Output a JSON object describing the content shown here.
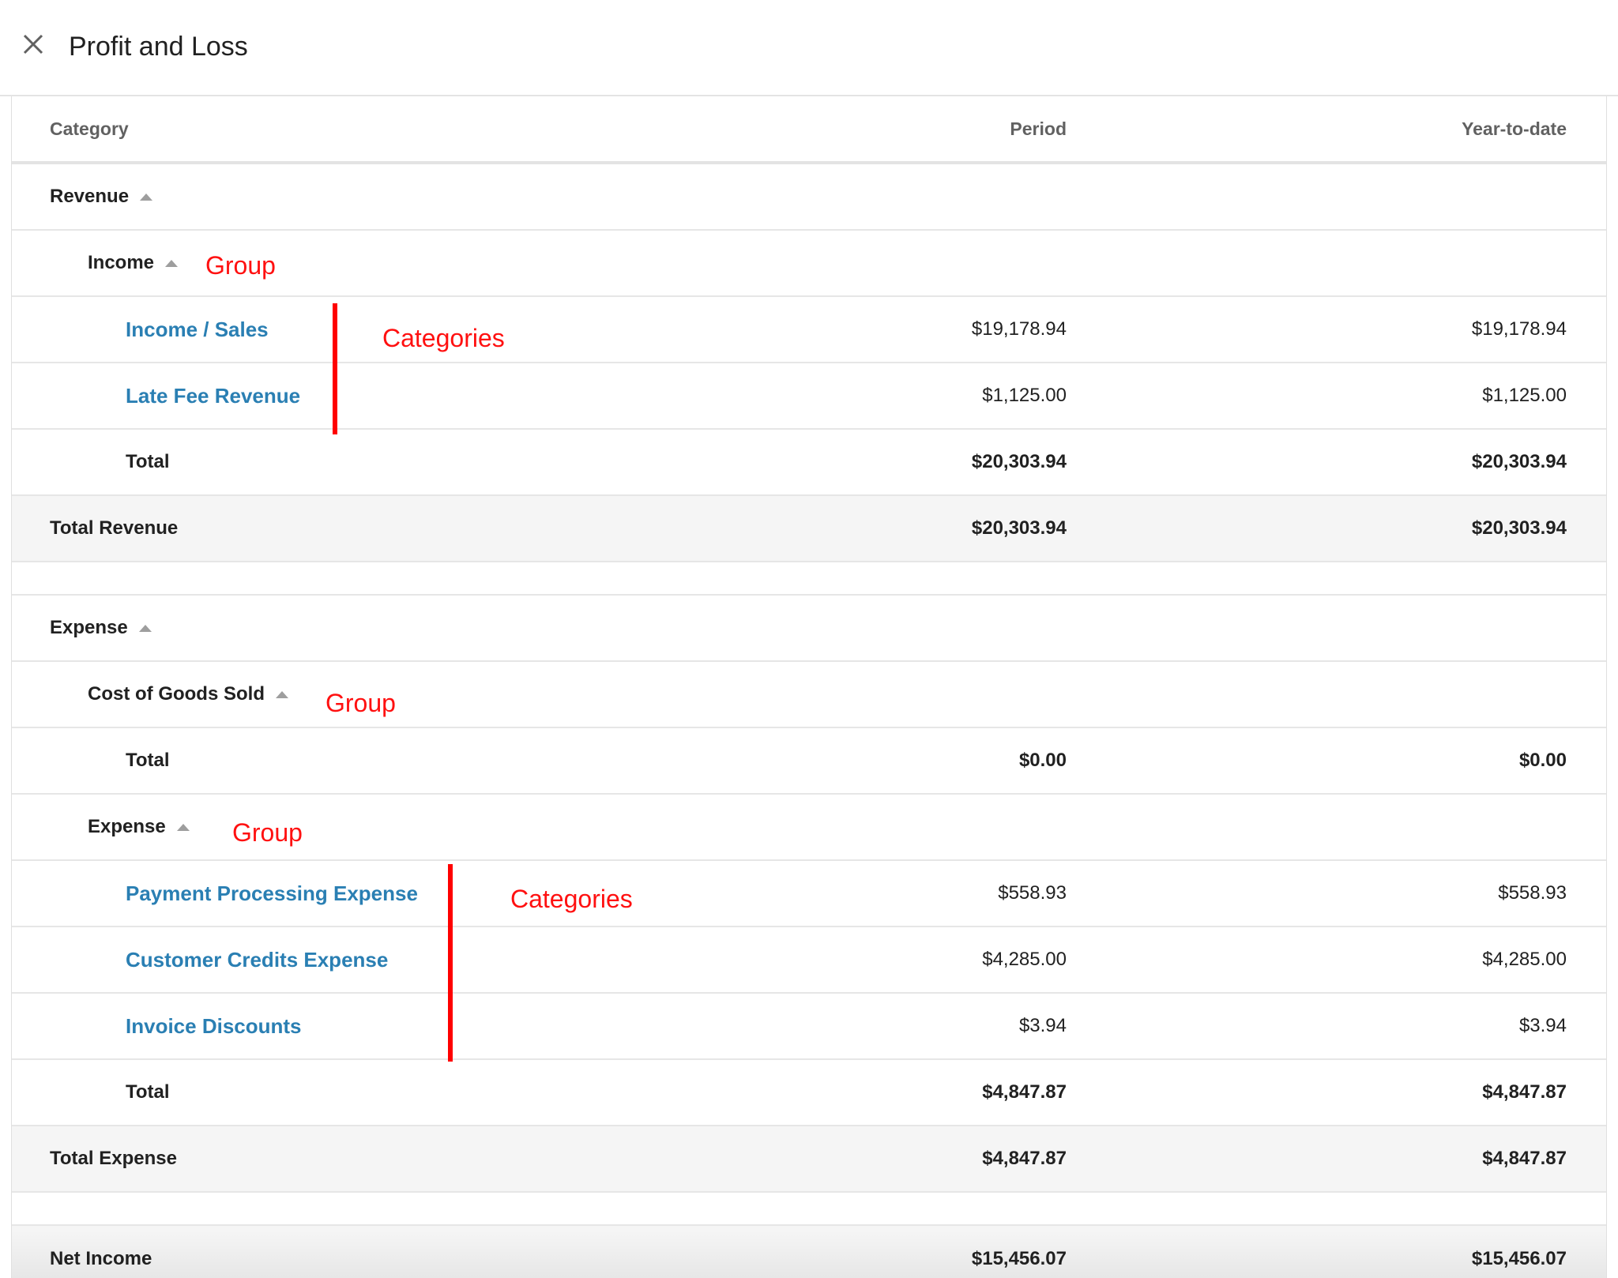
{
  "header": {
    "title": "Profit and Loss",
    "close_icon": "close-icon"
  },
  "columns": {
    "category": "Category",
    "period": "Period",
    "ytd": "Year-to-date"
  },
  "revenue": {
    "label": "Revenue",
    "income_group": {
      "label": "Income",
      "categories": [
        {
          "name": "Income / Sales",
          "period": "$19,178.94",
          "ytd": "$19,178.94"
        },
        {
          "name": "Late Fee Revenue",
          "period": "$1,125.00",
          "ytd": "$1,125.00"
        }
      ],
      "total_label": "Total",
      "total_period": "$20,303.94",
      "total_ytd": "$20,303.94"
    },
    "total_label": "Total Revenue",
    "total_period": "$20,303.94",
    "total_ytd": "$20,303.94"
  },
  "expense": {
    "label": "Expense",
    "cogs_group": {
      "label": "Cost of Goods Sold",
      "total_label": "Total",
      "total_period": "$0.00",
      "total_ytd": "$0.00"
    },
    "expense_group": {
      "label": "Expense",
      "categories": [
        {
          "name": "Payment Processing Expense",
          "period": "$558.93",
          "ytd": "$558.93"
        },
        {
          "name": "Customer Credits Expense",
          "period": "$4,285.00",
          "ytd": "$4,285.00"
        },
        {
          "name": "Invoice Discounts",
          "period": "$3.94",
          "ytd": "$3.94"
        }
      ],
      "total_label": "Total",
      "total_period": "$4,847.87",
      "total_ytd": "$4,847.87"
    },
    "total_label": "Total Expense",
    "total_period": "$4,847.87",
    "total_ytd": "$4,847.87"
  },
  "net_income": {
    "label": "Net Income",
    "period": "$15,456.07",
    "ytd": "$15,456.07"
  },
  "annotations": {
    "group_1": "Group",
    "categories_1": "Categories",
    "group_2": "Group",
    "group_3": "Group",
    "categories_2": "Categories",
    "color": "#ff0000"
  },
  "colors": {
    "link": "#2a7fb3",
    "total_row_bg": "#f5f5f5"
  }
}
